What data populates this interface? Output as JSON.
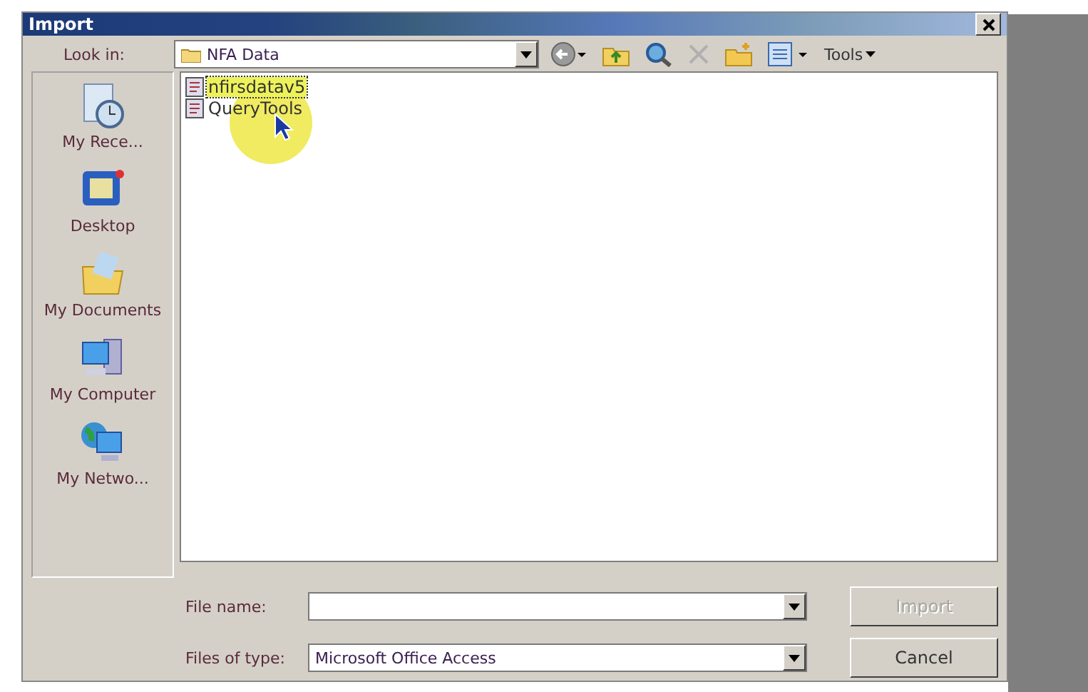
{
  "window": {
    "title": "Import"
  },
  "look_in": {
    "label": "Look in:",
    "value": "NFA Data"
  },
  "toolbar": {
    "tools_label": "Tools"
  },
  "places": [
    {
      "label": "My Rece...",
      "kind": "recent"
    },
    {
      "label": "Desktop",
      "kind": "desktop"
    },
    {
      "label": "My Documents",
      "kind": "documents"
    },
    {
      "label": "My Computer",
      "kind": "computer"
    },
    {
      "label": "My Netwo...",
      "kind": "network"
    }
  ],
  "files": [
    {
      "name": "nfirsdatav5",
      "selected": true
    },
    {
      "name": "QueryTools",
      "selected": false
    }
  ],
  "file_name": {
    "label": "File name:"
  },
  "file_type": {
    "label": "Files of type:",
    "value": "Microsoft Office Access"
  },
  "buttons": [
    {
      "label": "Import",
      "disabled": true
    },
    {
      "label": "Cancel",
      "disabled": false
    }
  ]
}
